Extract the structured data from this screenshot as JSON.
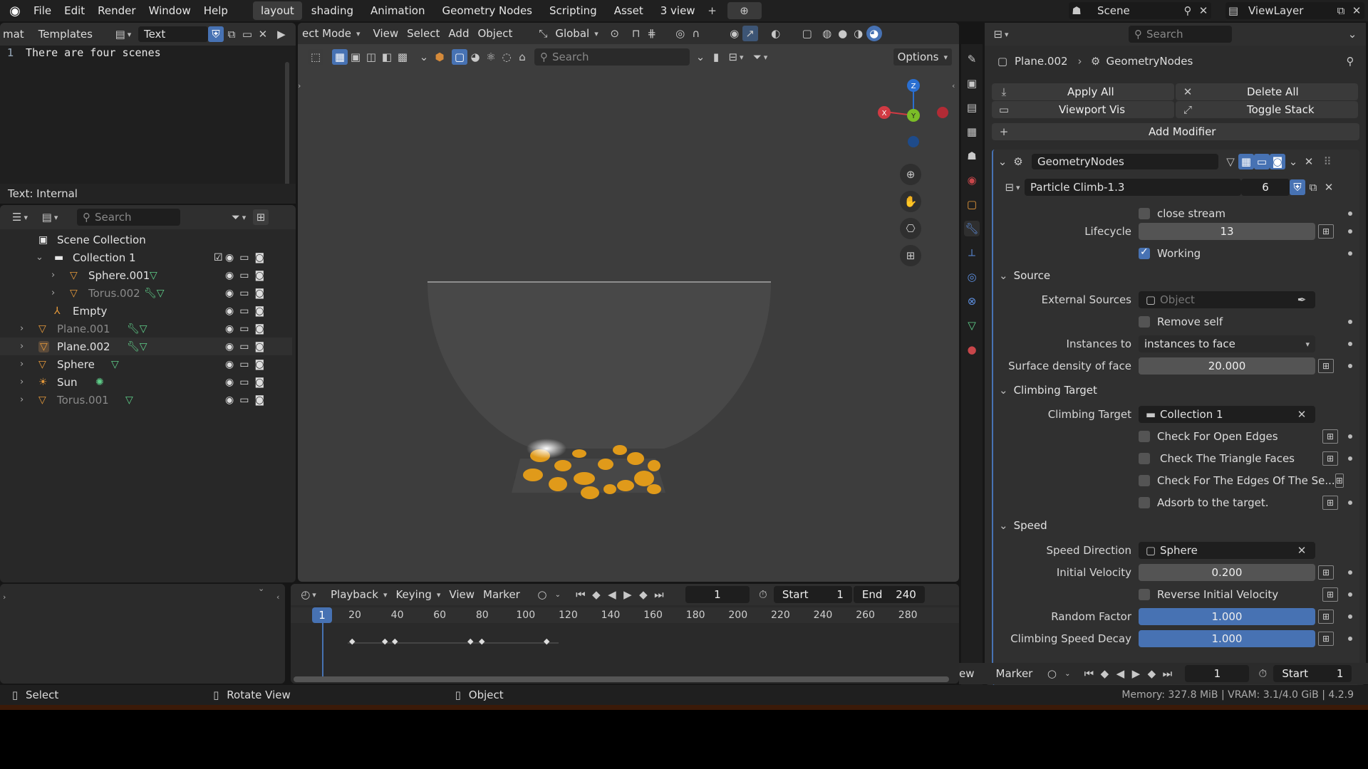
{
  "topbar": {
    "menus": [
      "File",
      "Edit",
      "Render",
      "Window",
      "Help"
    ],
    "workspaces": [
      "layout",
      "shading",
      "Animation",
      "Geometry Nodes",
      "Scripting",
      "Asset",
      "3 view"
    ],
    "active_workspace": "layout",
    "scene_label": "Scene",
    "viewlayer_label": "ViewLayer"
  },
  "text_editor": {
    "menu_mat": "mat",
    "menu_templates": "Templates",
    "text_name": "Text",
    "line_number": "1",
    "content": "There are four scenes",
    "footer": "Text: Internal"
  },
  "viewport": {
    "mode": "ect Mode",
    "menus": [
      "View",
      "Select",
      "Add",
      "Object"
    ],
    "transform_orientation": "Global",
    "search_placeholder": "Search",
    "options_label": "Options",
    "axis_x": "X",
    "axis_y": "Y",
    "axis_z": "Z"
  },
  "outliner": {
    "search_placeholder": "Search",
    "items": [
      {
        "label": "Scene Collection",
        "indent": 0,
        "icon": "scene-collection-icon",
        "glyph": "▣"
      },
      {
        "label": "Collection 1",
        "indent": 1,
        "icon": "collection-icon",
        "glyph": "▬"
      },
      {
        "label": "Sphere.001",
        "indent": 2,
        "icon": "mesh-icon",
        "glyph": "▽"
      },
      {
        "label": "Torus.002",
        "indent": 2,
        "icon": "mesh-icon",
        "glyph": "▽"
      },
      {
        "label": "Empty",
        "indent": 1,
        "icon": "empty-icon",
        "glyph": "⅄"
      },
      {
        "label": "Plane.001",
        "indent": 0,
        "icon": "mesh-icon",
        "glyph": "▽"
      },
      {
        "label": "Plane.002",
        "indent": 0,
        "icon": "mesh-icon",
        "glyph": "▽"
      },
      {
        "label": "Sphere",
        "indent": 0,
        "icon": "mesh-icon",
        "glyph": "▽"
      },
      {
        "label": "Sun",
        "indent": 0,
        "icon": "light-icon",
        "glyph": "☀"
      },
      {
        "label": "Torus.001",
        "indent": 0,
        "icon": "mesh-icon",
        "glyph": "▽"
      }
    ]
  },
  "timeline": {
    "menus": [
      "Playback",
      "Keying",
      "View",
      "Marker"
    ],
    "current_frame": "1",
    "start_label": "Start",
    "start_value": "1",
    "end_label": "End",
    "end_value": "240",
    "ruler": [
      "20",
      "40",
      "60",
      "80",
      "100",
      "120",
      "140",
      "160",
      "180",
      "200",
      "220",
      "240",
      "260",
      "280"
    ],
    "playhead": "1"
  },
  "properties": {
    "search_placeholder": "Search",
    "breadcrumb_object": "Plane.002",
    "breadcrumb_modifier": "GeometryNodes",
    "apply_all": "Apply All",
    "delete_all": "Delete All",
    "viewport_vis": "Viewport Vis",
    "toggle_stack": "Toggle Stack",
    "add_modifier": "Add Modifier",
    "modifier_name": "GeometryNodes",
    "node_group": "Particle Climb-1.3",
    "node_group_users": "6",
    "close_stream": "close stream",
    "lifecycle_label": "Lifecycle",
    "lifecycle_value": "13",
    "working": "Working",
    "source": "Source",
    "external_sources_label": "External Sources",
    "external_sources_placeholder": "Object",
    "remove_self": "Remove self",
    "instances_to_label": "Instances to",
    "instances_to_value": "instances to face",
    "surface_density_label": "Surface density of face",
    "surface_density_value": "20.000",
    "climbing_target_section": "Climbing Target",
    "climbing_target_label": "Climbing Target",
    "climbing_target_value": "Collection 1",
    "check_open_edges": "Check For Open Edges",
    "check_triangle_faces": "Check The Triangle Faces",
    "check_edges_of": "Check For The Edges Of The Se...",
    "adsorb_target": "Adsorb to the target.",
    "speed_section": "Speed",
    "speed_direction_label": "Speed Direction",
    "speed_direction_value": "Sphere",
    "initial_velocity_label": "Initial Velocity",
    "initial_velocity_value": "0.200",
    "reverse_initial_velocity": "Reverse Initial Velocity",
    "random_factor_label": "Random Factor",
    "random_factor_value": "1.000",
    "climbing_speed_decay_label": "Climbing Speed Decay",
    "climbing_speed_decay_value": "1.000",
    "bottom_marker": "Marker",
    "bottom_frame": "1",
    "bottom_start_label": "Start",
    "bottom_start_value": "1",
    "bottom_ew": "ew"
  },
  "statusbar": {
    "select": "Select",
    "rotate_view": "Rotate View",
    "object": "Object",
    "memory": "Memory: 327.8 MiB | VRAM: 3.1/4.0 GiB | 4.2.9"
  },
  "colors": {
    "accent": "#4772b3",
    "particles": "#e09a1a"
  }
}
